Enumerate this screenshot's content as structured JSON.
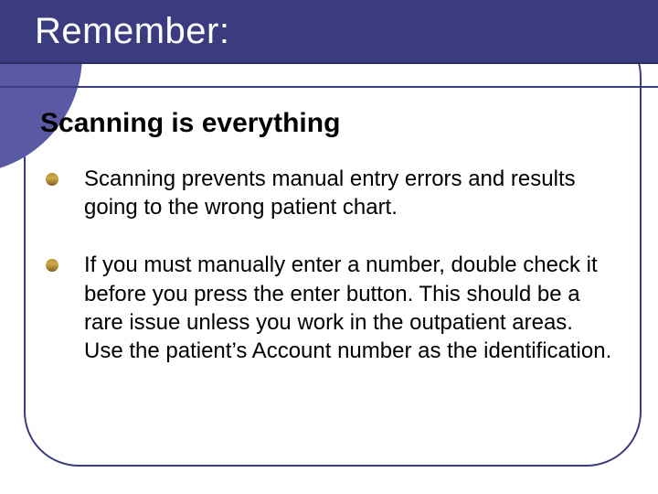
{
  "title": "Remember:",
  "heading": "Scanning is everything",
  "bullets": [
    "Scanning prevents manual entry errors and results going to the wrong patient chart.",
    "If you must manually enter a number, double check it before you press the enter button. This should be a rare issue unless you work in the outpatient areas. Use the patient’s Account number as the identification."
  ]
}
